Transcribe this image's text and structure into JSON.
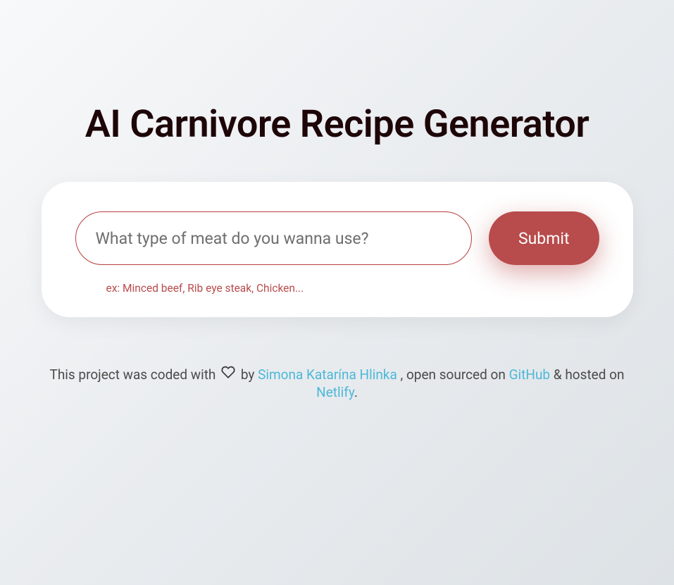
{
  "header": {
    "title": "AI Carnivore Recipe Generator"
  },
  "form": {
    "input_placeholder": "What type of meat do you wanna use?",
    "submit_label": "Submit",
    "hint": "ex: Minced beef, Rib eye steak, Chicken..."
  },
  "footer": {
    "prefix": "This project was coded with ",
    "by": " by ",
    "author": "Simona Katarína Hlinka",
    "open_sourced": " , open sourced on ",
    "github": "GitHub",
    "hosted": " & hosted on ",
    "netlify": "Netlify",
    "period": "."
  }
}
